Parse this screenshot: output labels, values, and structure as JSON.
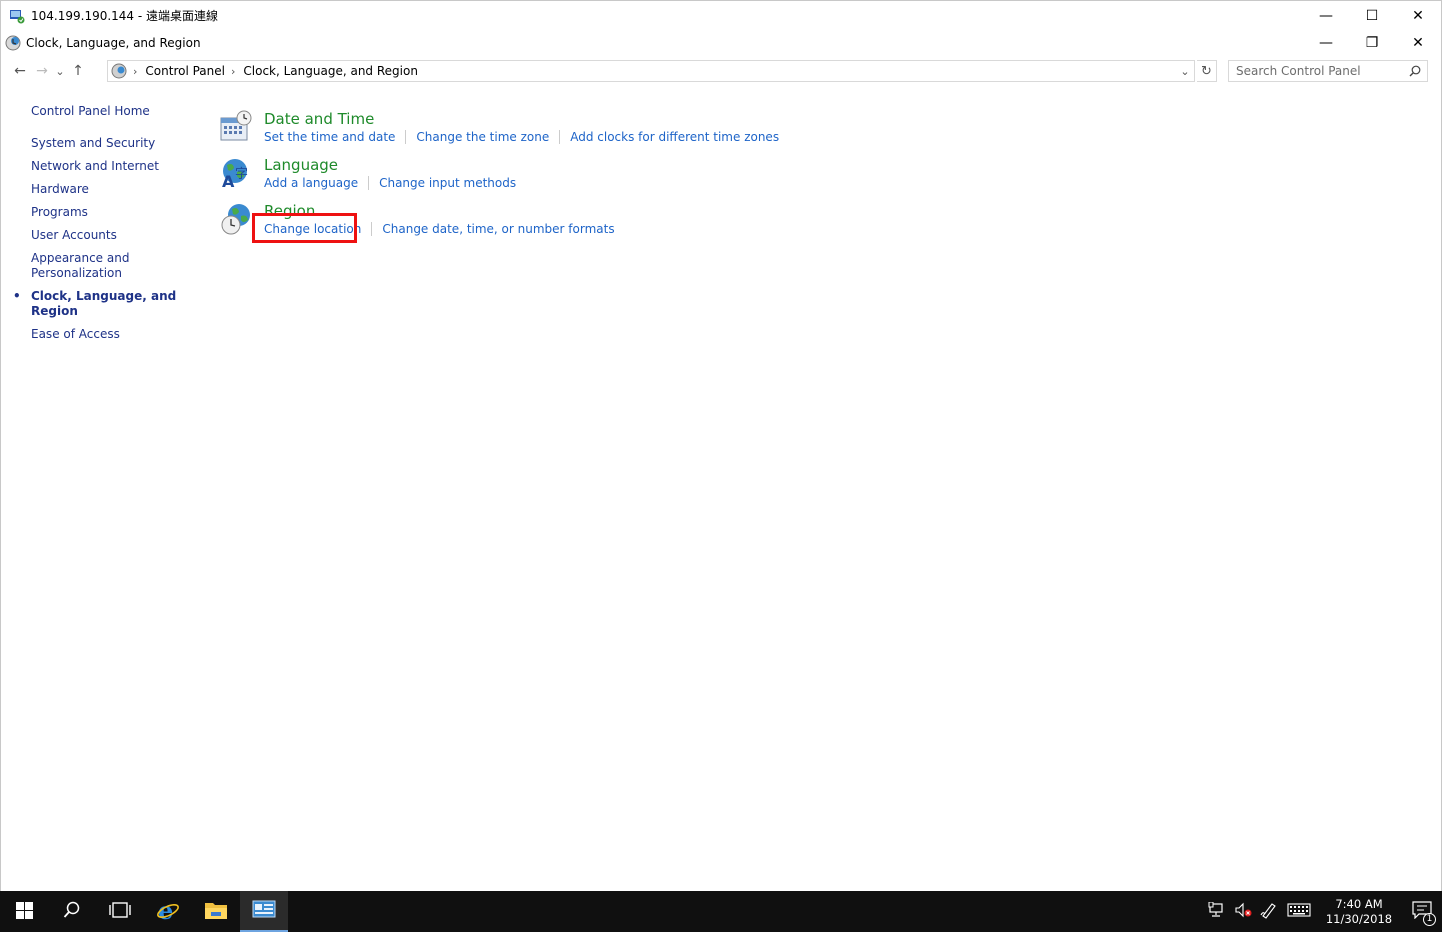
{
  "rdp_window": {
    "title": "104.199.190.144 - 遠端桌面連線",
    "minimize": "—",
    "maximize": "☐",
    "close": "✕"
  },
  "explorer_window": {
    "title": "Clock, Language, and Region",
    "minimize": "—",
    "restore": "❐",
    "close": "✕"
  },
  "navigation": {
    "back": "←",
    "forward": "→",
    "recent": "⌄",
    "up": "↑",
    "breadcrumbs": [
      "Control Panel",
      "Clock, Language, and Region"
    ],
    "separator": "›",
    "dropdown": "⌄",
    "refresh": "↻",
    "search_placeholder": "Search Control Panel"
  },
  "sidebar": {
    "home": "Control Panel Home",
    "items": [
      {
        "label": "System and Security"
      },
      {
        "label": "Network and Internet"
      },
      {
        "label": "Hardware"
      },
      {
        "label": "Programs"
      },
      {
        "label": "User Accounts"
      },
      {
        "label": "Appearance and Personalization"
      },
      {
        "label": "Clock, Language, and Region",
        "active": true
      },
      {
        "label": "Ease of Access"
      }
    ]
  },
  "categories": [
    {
      "title": "Date and Time",
      "links": [
        "Set the time and date",
        "Change the time zone",
        "Add clocks for different time zones"
      ]
    },
    {
      "title": "Language",
      "links": [
        "Add a language",
        "Change input methods"
      ]
    },
    {
      "title": "Region",
      "links": [
        "Change location",
        "Change date, time, or number formats"
      ]
    }
  ],
  "taskbar": {
    "time": "7:40 AM",
    "date": "11/30/2018",
    "notification_count": "1"
  },
  "colors": {
    "category_title": "#1e8a2a",
    "link": "#1e64c8",
    "sidebar_link": "#1e3287",
    "highlight": "#ee1111",
    "taskbar": "#101010"
  }
}
